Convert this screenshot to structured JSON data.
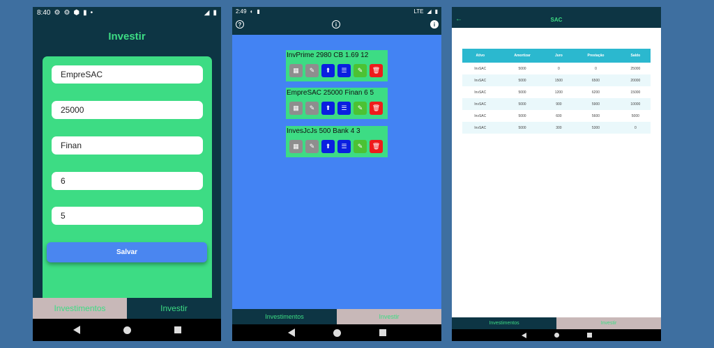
{
  "colors": {
    "bg": "#3e6fa0",
    "dark": "#0d3544",
    "green": "#3ddc84",
    "blue": "#4383f3",
    "teal": "#2bb8cf",
    "tab_inactive": "#c8b8b8"
  },
  "phone1": {
    "status_time": "8:40",
    "title": "Investir",
    "fields": [
      "EmpreSAC",
      "25000",
      "Finan",
      "6",
      "5"
    ],
    "save_label": "Salvar",
    "tabs": [
      "Investimentos",
      "Investir"
    ]
  },
  "phone2": {
    "status_time": "2:49",
    "status_network": "LTE",
    "investments": [
      {
        "label": "InvPrime 2980 CB 1.69 12"
      },
      {
        "label": "EmpreSAC 25000 Finan 6 5"
      },
      {
        "label": "InvesJcJs 500 Bank 4 3"
      }
    ],
    "button_icons": [
      "grid-icon",
      "image-edit-icon",
      "upload-icon",
      "list-icon",
      "edit-icon",
      "delete-icon"
    ],
    "tabs": [
      "Investimentos",
      "Investir"
    ]
  },
  "phone3": {
    "title": "SAC",
    "table": {
      "headers": [
        "Ativo",
        "Amortizar",
        "Juro",
        "Prestação",
        "Saldo"
      ],
      "rows": [
        [
          "InvSAC",
          "5000",
          "0",
          "0",
          "25000"
        ],
        [
          "InvSAC",
          "5000",
          "1500",
          "6500",
          "20000"
        ],
        [
          "InvSAC",
          "5000",
          "1200",
          "6200",
          "15000"
        ],
        [
          "InvSAC",
          "5000",
          "900",
          "5900",
          "10000"
        ],
        [
          "InvSAC",
          "5000",
          "600",
          "5600",
          "5000"
        ],
        [
          "InvSAC",
          "5000",
          "300",
          "5300",
          "0"
        ]
      ]
    },
    "tabs": [
      "Investimentos",
      "Investir"
    ]
  }
}
